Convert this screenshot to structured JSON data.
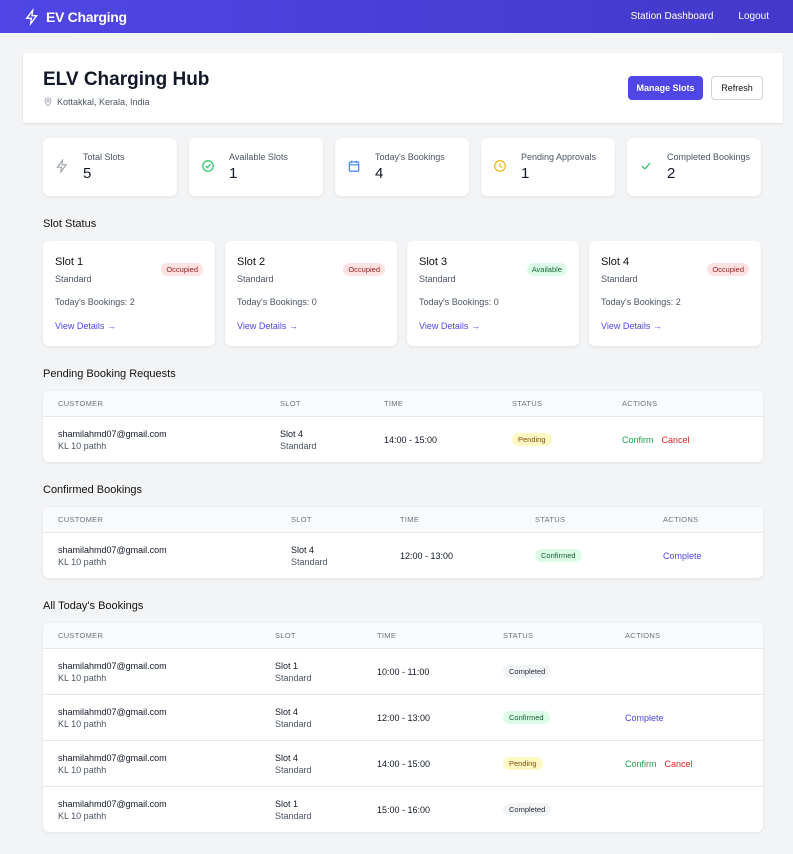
{
  "nav": {
    "brand": "EV Charging",
    "links": [
      "Station Dashboard",
      "Logout"
    ]
  },
  "header": {
    "title": "ELV Charging Hub",
    "location": "Kottakkal, Kerala, India",
    "manage": "Manage Slots",
    "refresh": "Refresh"
  },
  "stats": [
    {
      "label": "Total Slots",
      "value": "5",
      "icon": "bolt-icon",
      "color": "#9ca3af"
    },
    {
      "label": "Available Slots",
      "value": "1",
      "icon": "check-circle-icon",
      "color": "#22c55e"
    },
    {
      "label": "Today's Bookings",
      "value": "4",
      "icon": "calendar-icon",
      "color": "#3b82f6"
    },
    {
      "label": "Pending Approvals",
      "value": "1",
      "icon": "clock-icon",
      "color": "#eab308"
    },
    {
      "label": "Completed Bookings",
      "value": "2",
      "icon": "check-icon",
      "color": "#22c55e"
    }
  ],
  "slot_section": "Slot Status",
  "slots": [
    {
      "name": "Slot 1",
      "type": "Standard",
      "status": "Occupied",
      "bookings": "Today's Bookings: 2",
      "link": "View Details →"
    },
    {
      "name": "Slot 2",
      "type": "Standard",
      "status": "Occupied",
      "bookings": "Today's Bookings: 0",
      "link": "View Details →"
    },
    {
      "name": "Slot 3",
      "type": "Standard",
      "status": "Available",
      "bookings": "Today's Bookings: 0",
      "link": "View Details →"
    },
    {
      "name": "Slot 4",
      "type": "Standard",
      "status": "Occupied",
      "bookings": "Today's Bookings: 2",
      "link": "View Details →"
    }
  ],
  "columns": [
    "CUSTOMER",
    "SLOT",
    "TIME",
    "STATUS",
    "ACTIONS"
  ],
  "tables": [
    {
      "title": "Pending Booking Requests",
      "rows": [
        {
          "email": "shamilahmd07@gmail.com",
          "vehicle": "KL 10 pathh",
          "slot": "Slot 4",
          "type": "Standard",
          "time": "14:00 - 15:00",
          "status": "Pending",
          "actions": [
            "Confirm",
            "Cancel"
          ]
        }
      ]
    },
    {
      "title": "Confirmed Bookings",
      "rows": [
        {
          "email": "shamilahmd07@gmail.com",
          "vehicle": "KL 10 pathh",
          "slot": "Slot 4",
          "type": "Standard",
          "time": "12:00 - 13:00",
          "status": "Confirmed",
          "actions": [
            "Complete"
          ]
        }
      ]
    },
    {
      "title": "All Today's Bookings",
      "rows": [
        {
          "email": "shamilahmd07@gmail.com",
          "vehicle": "KL 10 pathh",
          "slot": "Slot 1",
          "type": "Standard",
          "time": "10:00 - 11:00",
          "status": "Completed",
          "actions": []
        },
        {
          "email": "shamilahmd07@gmail.com",
          "vehicle": "KL 10 pathh",
          "slot": "Slot 4",
          "type": "Standard",
          "time": "12:00 - 13:00",
          "status": "Confirmed",
          "actions": [
            "Complete"
          ]
        },
        {
          "email": "shamilahmd07@gmail.com",
          "vehicle": "KL 10 pathh",
          "slot": "Slot 4",
          "type": "Standard",
          "time": "14:00 - 15:00",
          "status": "Pending",
          "actions": [
            "Confirm",
            "Cancel"
          ]
        },
        {
          "email": "shamilahmd07@gmail.com",
          "vehicle": "KL 10 pathh",
          "slot": "Slot 1",
          "type": "Standard",
          "time": "15:00 - 16:00",
          "status": "Completed",
          "actions": []
        }
      ]
    }
  ]
}
